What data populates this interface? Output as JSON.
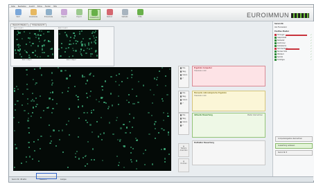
{
  "menu": [
    "Datei",
    "Bearbeiten",
    "Ansicht",
    "Extras",
    "Fenster",
    "Hilfe"
  ],
  "toolbar": {
    "buttons": [
      {
        "label": "Start",
        "color": "#7aa7d9"
      },
      {
        "label": "Arbeitsliste",
        "color": "#e6b861"
      },
      {
        "label": "Probenliste",
        "color": "#8fb0c9"
      },
      {
        "label": "Import",
        "color": "#c9a6d6"
      },
      {
        "label": "Export",
        "color": "#9cc98e"
      },
      {
        "label": "Auswertung",
        "color": "#67b048"
      },
      {
        "label": "Befund",
        "color": "#d4676f"
      },
      {
        "label": "Statistik",
        "color": "#a8b4bf"
      },
      {
        "label": "Hilfe",
        "color": "#69b04a"
      }
    ],
    "active_index": 5
  },
  "logo": {
    "text": "EUROIMMUN"
  },
  "tabs": [
    "Übersicht (Tabelle)",
    "Probenübersicht"
  ],
  "thumbs": {
    "header_left": "Bild 1 / Feld 1",
    "header_right": "Bild 2 / Feld 1",
    "label_left": "Bild 1 / HEp-2",
    "label_right": "Bild 2 / HEp-2"
  },
  "evaluation": {
    "rows": [
      {
        "radio": [
          "Pos.",
          "Neg.",
          "Grenz.",
          "?"
        ],
        "title": "Ergebnis Computer",
        "sub": "Titerstufe 1:100",
        "style": "red"
      },
      {
        "radio": [
          "Pos.",
          "Neg.",
          "Grenz.",
          "?"
        ],
        "title": "Manuelle mikroskopische Ergebnis",
        "sub": "Titerstufe 1:100",
        "style": "yellow"
      },
      {
        "radio": [
          "Pos.",
          "Neg.",
          "Grenz.",
          "?"
        ],
        "title": "Aktuelle Bewertung",
        "sub": "",
        "style": "green",
        "extra": "Muster übernehmen"
      }
    ],
    "final": {
      "title": "Endfaktor Bewertung"
    },
    "side_buttons": [
      "Weitere Ansichten",
      "Drucken"
    ]
  },
  "right": {
    "title": "Serum Nr.",
    "subtitle": "Alle Fluoreszenz",
    "section": "Positive Muster",
    "items": [
      {
        "label": "Homogen",
        "color": "#c8323c",
        "bar": 0.9
      },
      {
        "label": "Gesprenkelt",
        "color": "#2e8b3a",
        "bar": 0
      },
      {
        "label": "Nukleolär",
        "color": "#2e8b3a",
        "bar": 0
      },
      {
        "label": "Zentromer",
        "color": "#2e8b3a",
        "bar": 0
      },
      {
        "label": "Zytoplasma",
        "color": "#2e8b3a",
        "bar": 0
      },
      {
        "label": "Kernmembran",
        "color": "#c8323c",
        "bar": 0.6
      },
      {
        "label": "Nuclear Dots",
        "color": "#2e8b3a",
        "bar": 0
      },
      {
        "label": "Mitotisch",
        "color": "#2e8b3a",
        "bar": 0
      },
      {
        "label": "Spindel",
        "color": "#2e8b3a",
        "bar": 0
      },
      {
        "label": "Sonstiges",
        "color": "#2e8b3a",
        "bar": 0
      }
    ],
    "bottom_buttons": [
      "Computerergebnis übernehmen",
      "Auswertung verlassen",
      "Serum Nr. 8"
    ]
  },
  "status": {
    "items": [
      "Serum Nr.: 98 aktiv",
      "Übersicht",
      "Analyse"
    ],
    "highlight_index": 1
  }
}
